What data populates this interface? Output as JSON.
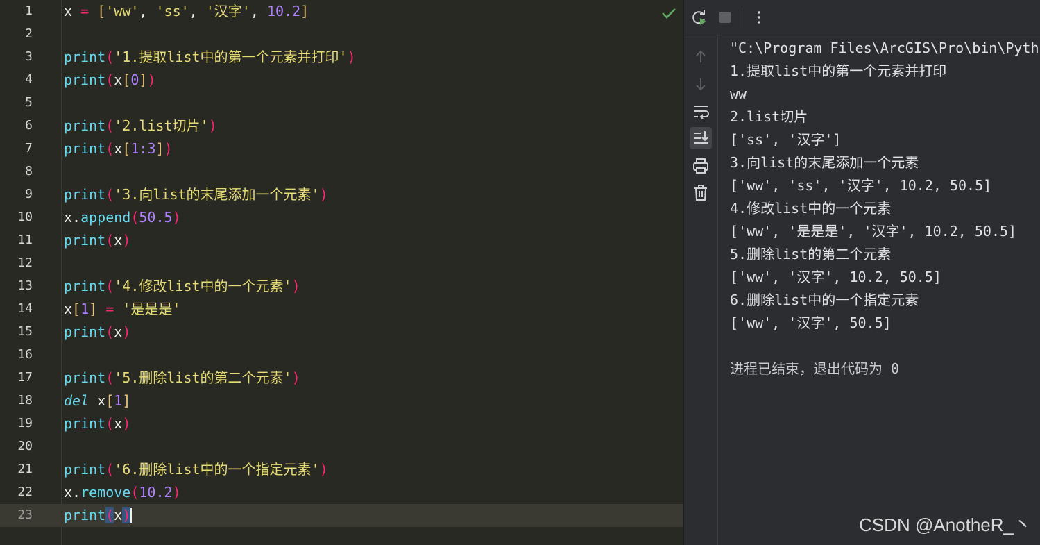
{
  "editor": {
    "current_line": 23,
    "lines": [
      {
        "n": "1"
      },
      {
        "n": "2"
      },
      {
        "n": "3"
      },
      {
        "n": "4"
      },
      {
        "n": "5"
      },
      {
        "n": "6"
      },
      {
        "n": "7"
      },
      {
        "n": "8"
      },
      {
        "n": "9"
      },
      {
        "n": "10"
      },
      {
        "n": "11"
      },
      {
        "n": "12"
      },
      {
        "n": "13"
      },
      {
        "n": "14"
      },
      {
        "n": "15"
      },
      {
        "n": "16"
      },
      {
        "n": "17"
      },
      {
        "n": "18"
      },
      {
        "n": "19"
      },
      {
        "n": "20"
      },
      {
        "n": "21"
      },
      {
        "n": "22"
      },
      {
        "n": "23"
      }
    ],
    "code": {
      "l1_var": "x",
      "l1_op": "=",
      "l1_s1": "'ww'",
      "l1_s2": "'ss'",
      "l1_s3": "'汉字'",
      "l1_n1": "10.2",
      "print": "print",
      "l3_str": "'1.提取list中的第一个元素并打印'",
      "l4_idx": "0",
      "l6_str": "'2.list切片'",
      "l7_idx": "1:3",
      "l9_str": "'3.向list的末尾添加一个元素'",
      "l10_method": "append",
      "l10_num": "50.5",
      "l13_str": "'4.修改list中的一个元素'",
      "l14_idx": "1",
      "l14_str": "'是是是'",
      "l17_str": "'5.删除list的第二个元素'",
      "l18_kw": "del",
      "l18_idx": "1",
      "l21_str": "'6.删除list中的一个指定元素'",
      "l22_method": "remove",
      "l22_num": "10.2"
    }
  },
  "run_panel": {
    "toolbar": {
      "rerun_icon": "rerun-icon",
      "stop_icon": "stop-icon",
      "more_icon": "more-vertical-icon"
    },
    "side_tools": [
      "arrow-up-icon",
      "arrow-down-icon",
      "soft-wrap-icon",
      "scroll-to-end-icon",
      "print-icon",
      "trash-icon"
    ],
    "console_lines": [
      "\"C:\\Program Files\\ArcGIS\\Pro\\bin\\Pytho",
      "1.提取list中的第一个元素并打印",
      "ww",
      "2.list切片",
      "['ss', '汉字']",
      "3.向list的末尾添加一个元素",
      "['ww', 'ss', '汉字', 10.2, 50.5]",
      "4.修改list中的一个元素",
      "['ww', '是是是', '汉字', 10.2, 50.5]",
      "5.删除list的第二个元素",
      "['ww', '汉字', 10.2, 50.5]",
      "6.删除list中的一个指定元素",
      "['ww', '汉字', 50.5]",
      "",
      "进程已结束，退出代码为 0"
    ]
  },
  "watermark": "CSDN @AnotheR_丶",
  "colors": {
    "editor_bg": "#282923",
    "function": "#66d9ef",
    "string": "#e6db74",
    "number": "#ae81ff",
    "operator": "#f92672",
    "check": "#5faa5f"
  }
}
